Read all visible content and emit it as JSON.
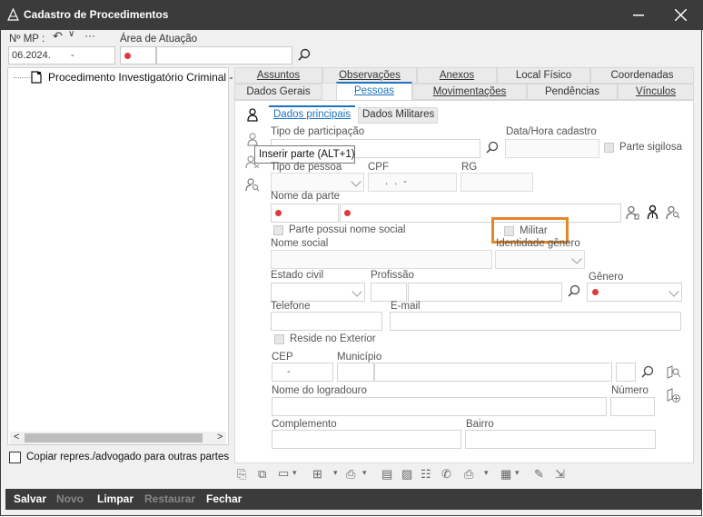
{
  "window": {
    "title": "Cadastro de Procedimentos"
  },
  "header": {
    "mp_label": "Nº MP :",
    "mp_value": "06.2024.",
    "mp_dash": "-",
    "area_label": "Área de Atuação"
  },
  "tree": {
    "item": "Procedimento Investigatório Criminal -"
  },
  "copy_checkbox_label": "Copiar repres./advogado para outras partes",
  "tabs_top": [
    "Assuntos",
    "Observações",
    "Anexos",
    "Local Físico",
    "Coordenadas"
  ],
  "tabs_bottom": [
    "Dados Gerais",
    "Pessoas",
    "Movimentações",
    "Pendências",
    "Vínculos"
  ],
  "subtabs": [
    "Dados principais",
    "Dados Militares"
  ],
  "tooltip": "Inserir parte (ALT+1)",
  "form": {
    "tipo_participacao": "Tipo de participação",
    "data_hora": "Data/Hora cadastro",
    "parte_sigilosa": "Parte sigilosa",
    "tipo_pessoa": "Tipo de pessoa",
    "cpf": "CPF",
    "cpf_mask": ". . -",
    "rg": "RG",
    "nome_parte": "Nome da parte",
    "parte_nome_social": "Parte possui nome social",
    "militar": "Militar",
    "nome_social": "Nome social",
    "identidade_genero": "Identidade gênero",
    "estado_civil": "Estado civil",
    "profissao": "Profissão",
    "genero": "Gênero",
    "telefone": "Telefone",
    "email": "E-mail",
    "reside_exterior": "Reside no Exterior",
    "cep": "CEP",
    "cep_mask": "-",
    "municipio": "Município",
    "nome_logradouro": "Nome do logradouro",
    "numero": "Número",
    "complemento": "Complemento",
    "bairro": "Bairro"
  },
  "buttons": {
    "salvar": "Salvar",
    "novo": "Novo",
    "limpar": "Limpar",
    "restaurar": "Restaurar",
    "fechar": "Fechar"
  },
  "colors": {
    "titlebar": "#3b3b3b",
    "required_dot": "#e0383e",
    "highlight_box": "#e6862a",
    "tab_accent": "#1e73be"
  }
}
